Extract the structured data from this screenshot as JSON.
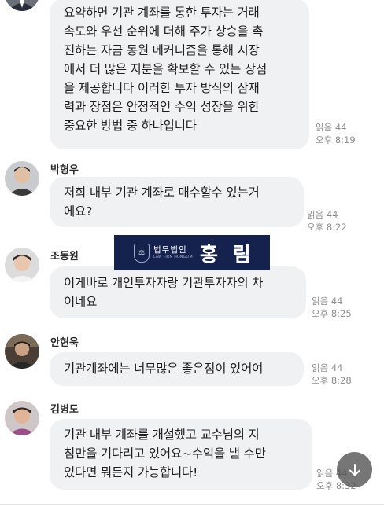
{
  "messages": [
    {
      "sender": "",
      "text": "요약하면 기관 계좌를 통한 투자는 거래\n속도와 우선 순위에 더해 주가 상승을 촉\n진하는 자금 동원 메커니즘을 통해 시장\n에서 더 많은 지분을 확보할 수 있는 장점\n을 제공합니다 이러한 투자 방식의 잠재\n력과 장점은 안정적인 수익 성장을 위한\n중요한 방법 중 하나입니다",
      "read": "읽음 44",
      "time": "오후 8:19"
    },
    {
      "sender": "박형우",
      "text": "저희 내부 기관 계좌로 매수할수 있는거\n에요?",
      "read": "읽음 44",
      "time": "오후 8:22"
    },
    {
      "sender": "조동원",
      "text": "이게바로 개인투자자랑 기관투자자의 차\n이네요",
      "read": "읽음 44",
      "time": "오후 8:25"
    },
    {
      "sender": "안현욱",
      "text": "기관계좌에는 너무많은 좋은점이 있어여",
      "read": "읽음 44",
      "time": "오후 8:28"
    },
    {
      "sender": "김병도",
      "text": "기관 내부 계좌를 개설했고 교수님의 지\n침만을 기다리고 있어요~수익을 낼 수만\n있다면 뭐든지 가능합니다!",
      "read": "읽음 44",
      "time": "오후 8:32"
    }
  ],
  "watermark": {
    "firm": "법무법인",
    "firm_en": "LAW FIRM HONGLIM",
    "brand": "홍 림"
  },
  "icons": {
    "scroll_down": "arrow-down-icon"
  }
}
